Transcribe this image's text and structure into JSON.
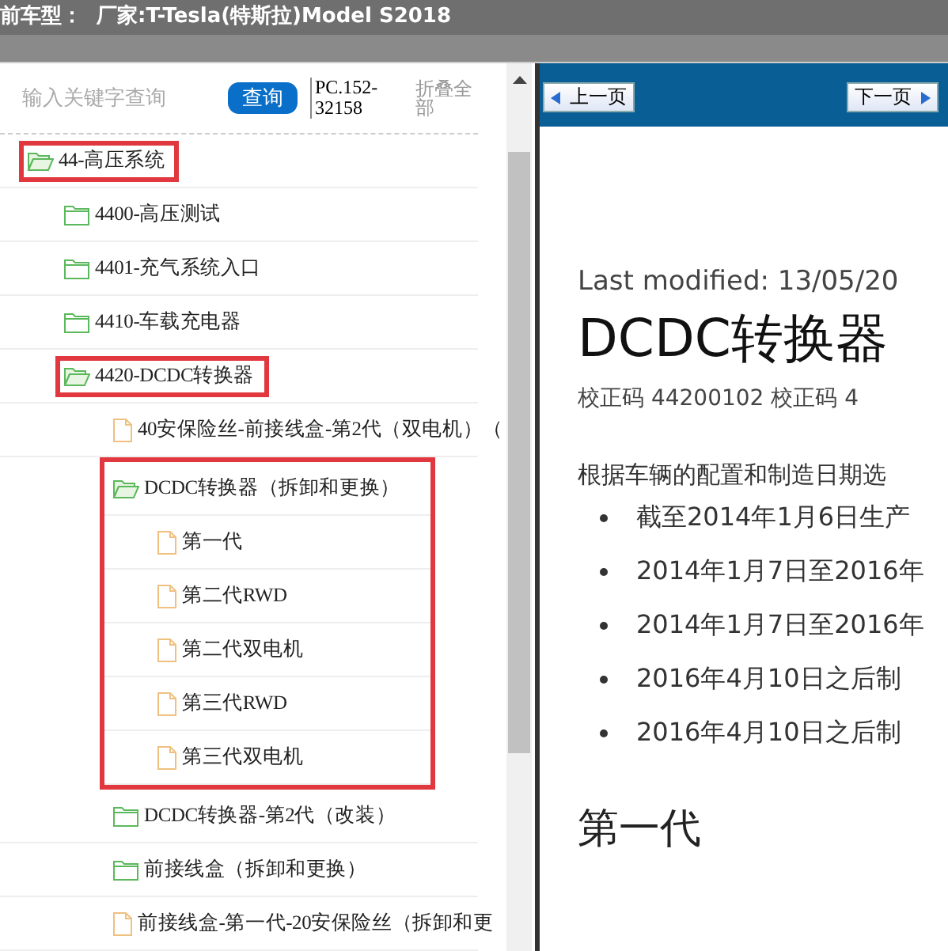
{
  "header": {
    "title": "前车型：  厂家:T-Tesla(特斯拉)Model S2018"
  },
  "search": {
    "placeholder": "输入关键字查询",
    "button": "查询",
    "code": "PC.152-32158",
    "collapse": "折叠全部"
  },
  "tree": [
    {
      "label": "44-高压系统",
      "kind": "folder",
      "expanded": true,
      "highlighted": true,
      "highlight_children": false,
      "children": [
        {
          "label": "4400-高压测试",
          "kind": "folder",
          "expanded": false,
          "highlighted": false
        },
        {
          "label": "4401-充气系统入口",
          "kind": "folder",
          "expanded": false,
          "highlighted": false
        },
        {
          "label": "4410-车载充电器",
          "kind": "folder",
          "expanded": false,
          "highlighted": false
        },
        {
          "label": "4420-DCDC转换器",
          "kind": "folder",
          "expanded": true,
          "highlighted": true,
          "highlight_children": false,
          "children": [
            {
              "label": "40安保险丝-前接线盒-第2代（双电机）（",
              "kind": "file",
              "highlighted": false
            },
            {
              "label": "DCDC转换器（拆卸和更换）",
              "kind": "folder",
              "expanded": true,
              "highlighted": true,
              "highlight_children": true,
              "children": [
                {
                  "label": "第一代",
                  "kind": "file",
                  "highlighted": false
                },
                {
                  "label": "第二代RWD",
                  "kind": "file",
                  "highlighted": false
                },
                {
                  "label": "第二代双电机",
                  "kind": "file",
                  "highlighted": false
                },
                {
                  "label": "第三代RWD",
                  "kind": "file",
                  "highlighted": false
                },
                {
                  "label": "第三代双电机",
                  "kind": "file",
                  "highlighted": false
                }
              ]
            },
            {
              "label": "DCDC转换器-第2代（改装）",
              "kind": "folder",
              "expanded": false,
              "highlighted": false
            },
            {
              "label": "前接线盒（拆卸和更换）",
              "kind": "folder",
              "expanded": false,
              "highlighted": false
            },
            {
              "label": "前接线盒-第一代-20安保险丝（拆卸和更",
              "kind": "file",
              "highlighted": false
            }
          ]
        }
      ]
    }
  ],
  "nav": {
    "prev": "上一页",
    "next": "下一页"
  },
  "document": {
    "modified": "Last modified: 13/05/20",
    "title": "DCDC转换器",
    "codes": "校正码 44200102 校正码 4",
    "intro": "根据车辆的配置和制造日期选",
    "bullets": [
      "截至2014年1月6日生产",
      "2014年1月7日至2016年",
      "2014年1月7日至2016年",
      "2016年4月10日之后制",
      "2016年4月10日之后制"
    ],
    "section": "第一代"
  }
}
